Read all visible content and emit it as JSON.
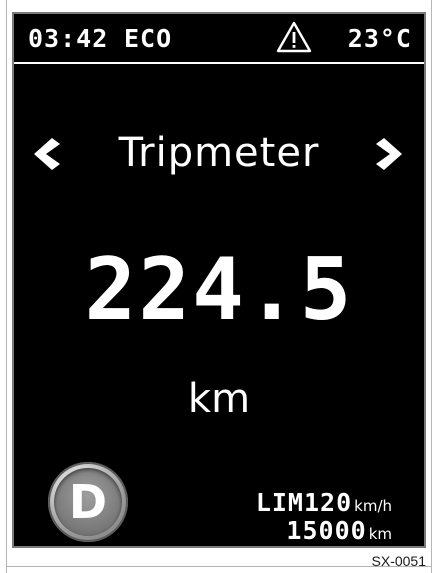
{
  "status_bar": {
    "time": "03:42",
    "mode": "ECO",
    "warning_icon": "warning-triangle-icon",
    "temperature": "23°C"
  },
  "navigation": {
    "prev_icon": "chevron-left-icon",
    "next_icon": "chevron-right-icon"
  },
  "main": {
    "title": "Tripmeter",
    "value": "224.5",
    "unit": "km"
  },
  "bottom": {
    "gear": "D",
    "limit_label": "LIM",
    "limit_value": "120",
    "limit_unit": "km/h",
    "odometer_value": "15000",
    "odometer_unit": "km"
  },
  "reference_code": "SX-0051",
  "colors": {
    "screen_background": "#000000",
    "text": "#ffffff",
    "bezel": "#7a7a7a"
  }
}
